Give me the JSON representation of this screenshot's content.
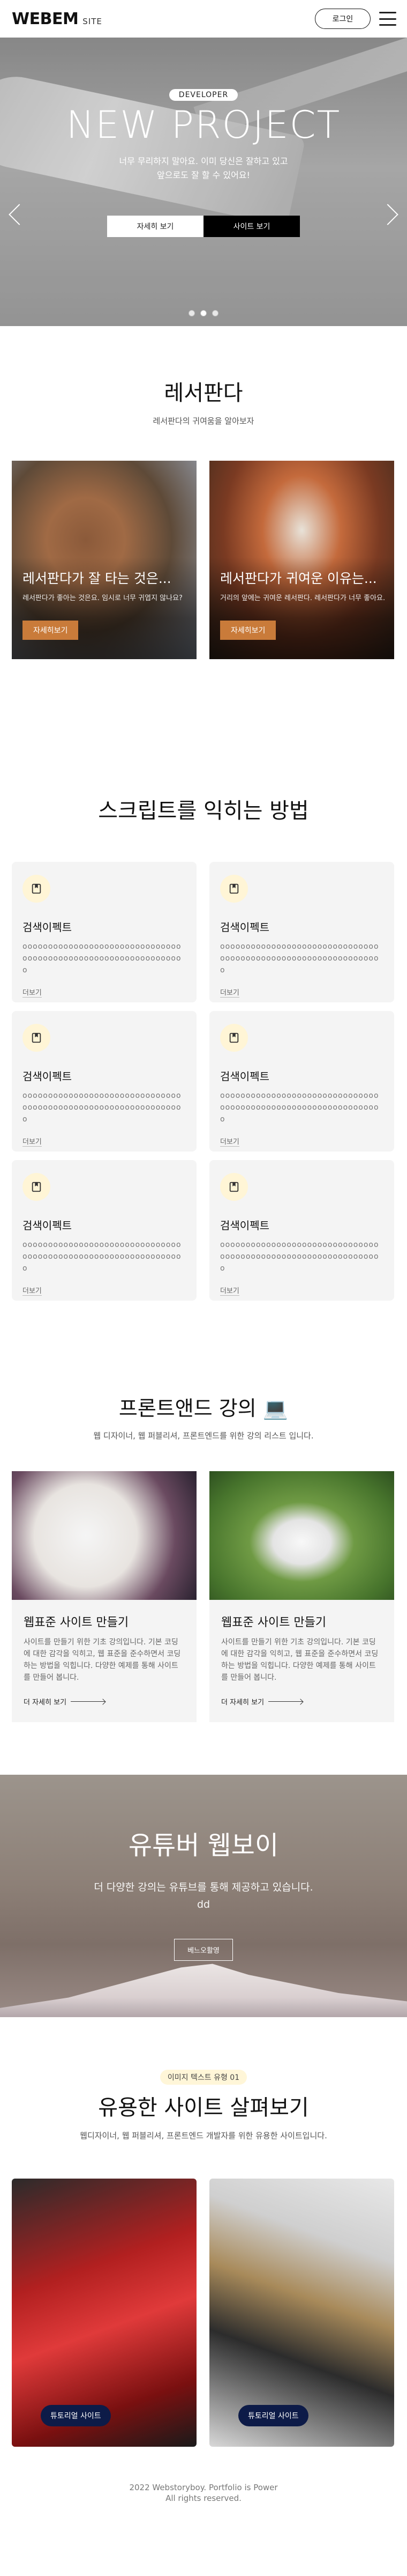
{
  "header": {
    "logo_main": "WEBEM",
    "logo_sub": "SITE",
    "login_label": "로그인"
  },
  "hero": {
    "badge": "DEVELOPER",
    "title": "NEW PROJECT",
    "desc_line1": "너무 무리하지 말아요. 이미 당신은 잘하고 있고",
    "desc_line2": "앞으로도 잘 할 수 있어요!",
    "btn_detail": "자세히 보기",
    "btn_site": "사이트 보기"
  },
  "panda": {
    "title": "레서판다",
    "desc": "레서판다의 귀여움을 알아보자",
    "cards": [
      {
        "title": "레서판다가 잘 타는 것은...",
        "desc": "레서판다가 좋아는 것은요. 임시로 너무 귀엽지 않나요?",
        "button": "자세히보기"
      },
      {
        "title": "레서판다가 귀여운 이유는...",
        "desc": "거리의 앞에는 귀여운 레서판다. 레서판다가 너무 좋아요.",
        "button": "자세히보기"
      }
    ]
  },
  "script": {
    "title": "스크립트를 익히는 방법",
    "cards": [
      {
        "title": "검색이펙트",
        "desc": "ooooooooooooooooooooooooooooooooooooooooooooooooooooooooooooooo",
        "link": "더보기"
      },
      {
        "title": "검색이펙트",
        "desc": "ooooooooooooooooooooooooooooooooooooooooooooooooooooooooooooooo",
        "link": "더보기"
      },
      {
        "title": "검색이펙트",
        "desc": "ooooooooooooooooooooooooooooooooooooooooooooooooooooooooooooooo",
        "link": "더보기"
      },
      {
        "title": "검색이펙트",
        "desc": "ooooooooooooooooooooooooooooooooooooooooooooooooooooooooooooooo",
        "link": "더보기"
      },
      {
        "title": "검색이펙트",
        "desc": "ooooooooooooooooooooooooooooooooooooooooooooooooooooooooooooooo",
        "link": "더보기"
      },
      {
        "title": "검색이펙트",
        "desc": "ooooooooooooooooooooooooooooooooooooooooooooooooooooooooooooooo",
        "link": "더보기"
      }
    ]
  },
  "front": {
    "title": "프론트앤드 강의 💻",
    "desc": "웹 디자이너, 웹 퍼블리셔, 프론트엔드를 위한 강의 리스트 입니다.",
    "cards": [
      {
        "title": "웹표준 사이트 만들기",
        "desc": "사이트를 만들기 위한 기초 강의입니다. 기본 코딩에 대한 감각을 익히고, 웹 표준을 준수하면서 코딩하는 방법을 익힙니다. 다양한 예제를 통해 사이트를 만들어 봅니다.",
        "link": "더 자세히 보기"
      },
      {
        "title": "웹표준 사이트 만들기",
        "desc": "사이트를 만들기 위한 기초 강의입니다. 기본 코딩에 대한 감각을 익히고, 웹 표준을 준수하면서 코딩하는 방법을 익힙니다. 다양한 예제를 통해 사이트를 만들어 봅니다.",
        "link": "더 자세히 보기"
      }
    ]
  },
  "youtube": {
    "title": "유튜버 웹보이",
    "desc_line1": "더 다양한 강의는 유튜브를 통해 제공하고 있습니다.",
    "desc_line2": "dd",
    "button": "베느오활영"
  },
  "sites": {
    "badge": "이미지 텍스트 유형 01",
    "title": "유용한 사이트 살펴보기",
    "desc": "웹디자이너, 웹 퍼블리셔, 프론트엔드 개발자를 위한 유용한 사이트입니다.",
    "cards": [
      {
        "button": "튜토리얼 사이트"
      },
      {
        "button": "튜토리얼 사이트"
      }
    ]
  },
  "footer": {
    "line1": "2022 Webstoryboy. Portfolio is Power",
    "line2": "All rights reserved."
  },
  "colors": {
    "panda_button": "#c97b3a",
    "site_button": "#0d1b48",
    "script_icon_bg": "#fff5d6"
  }
}
